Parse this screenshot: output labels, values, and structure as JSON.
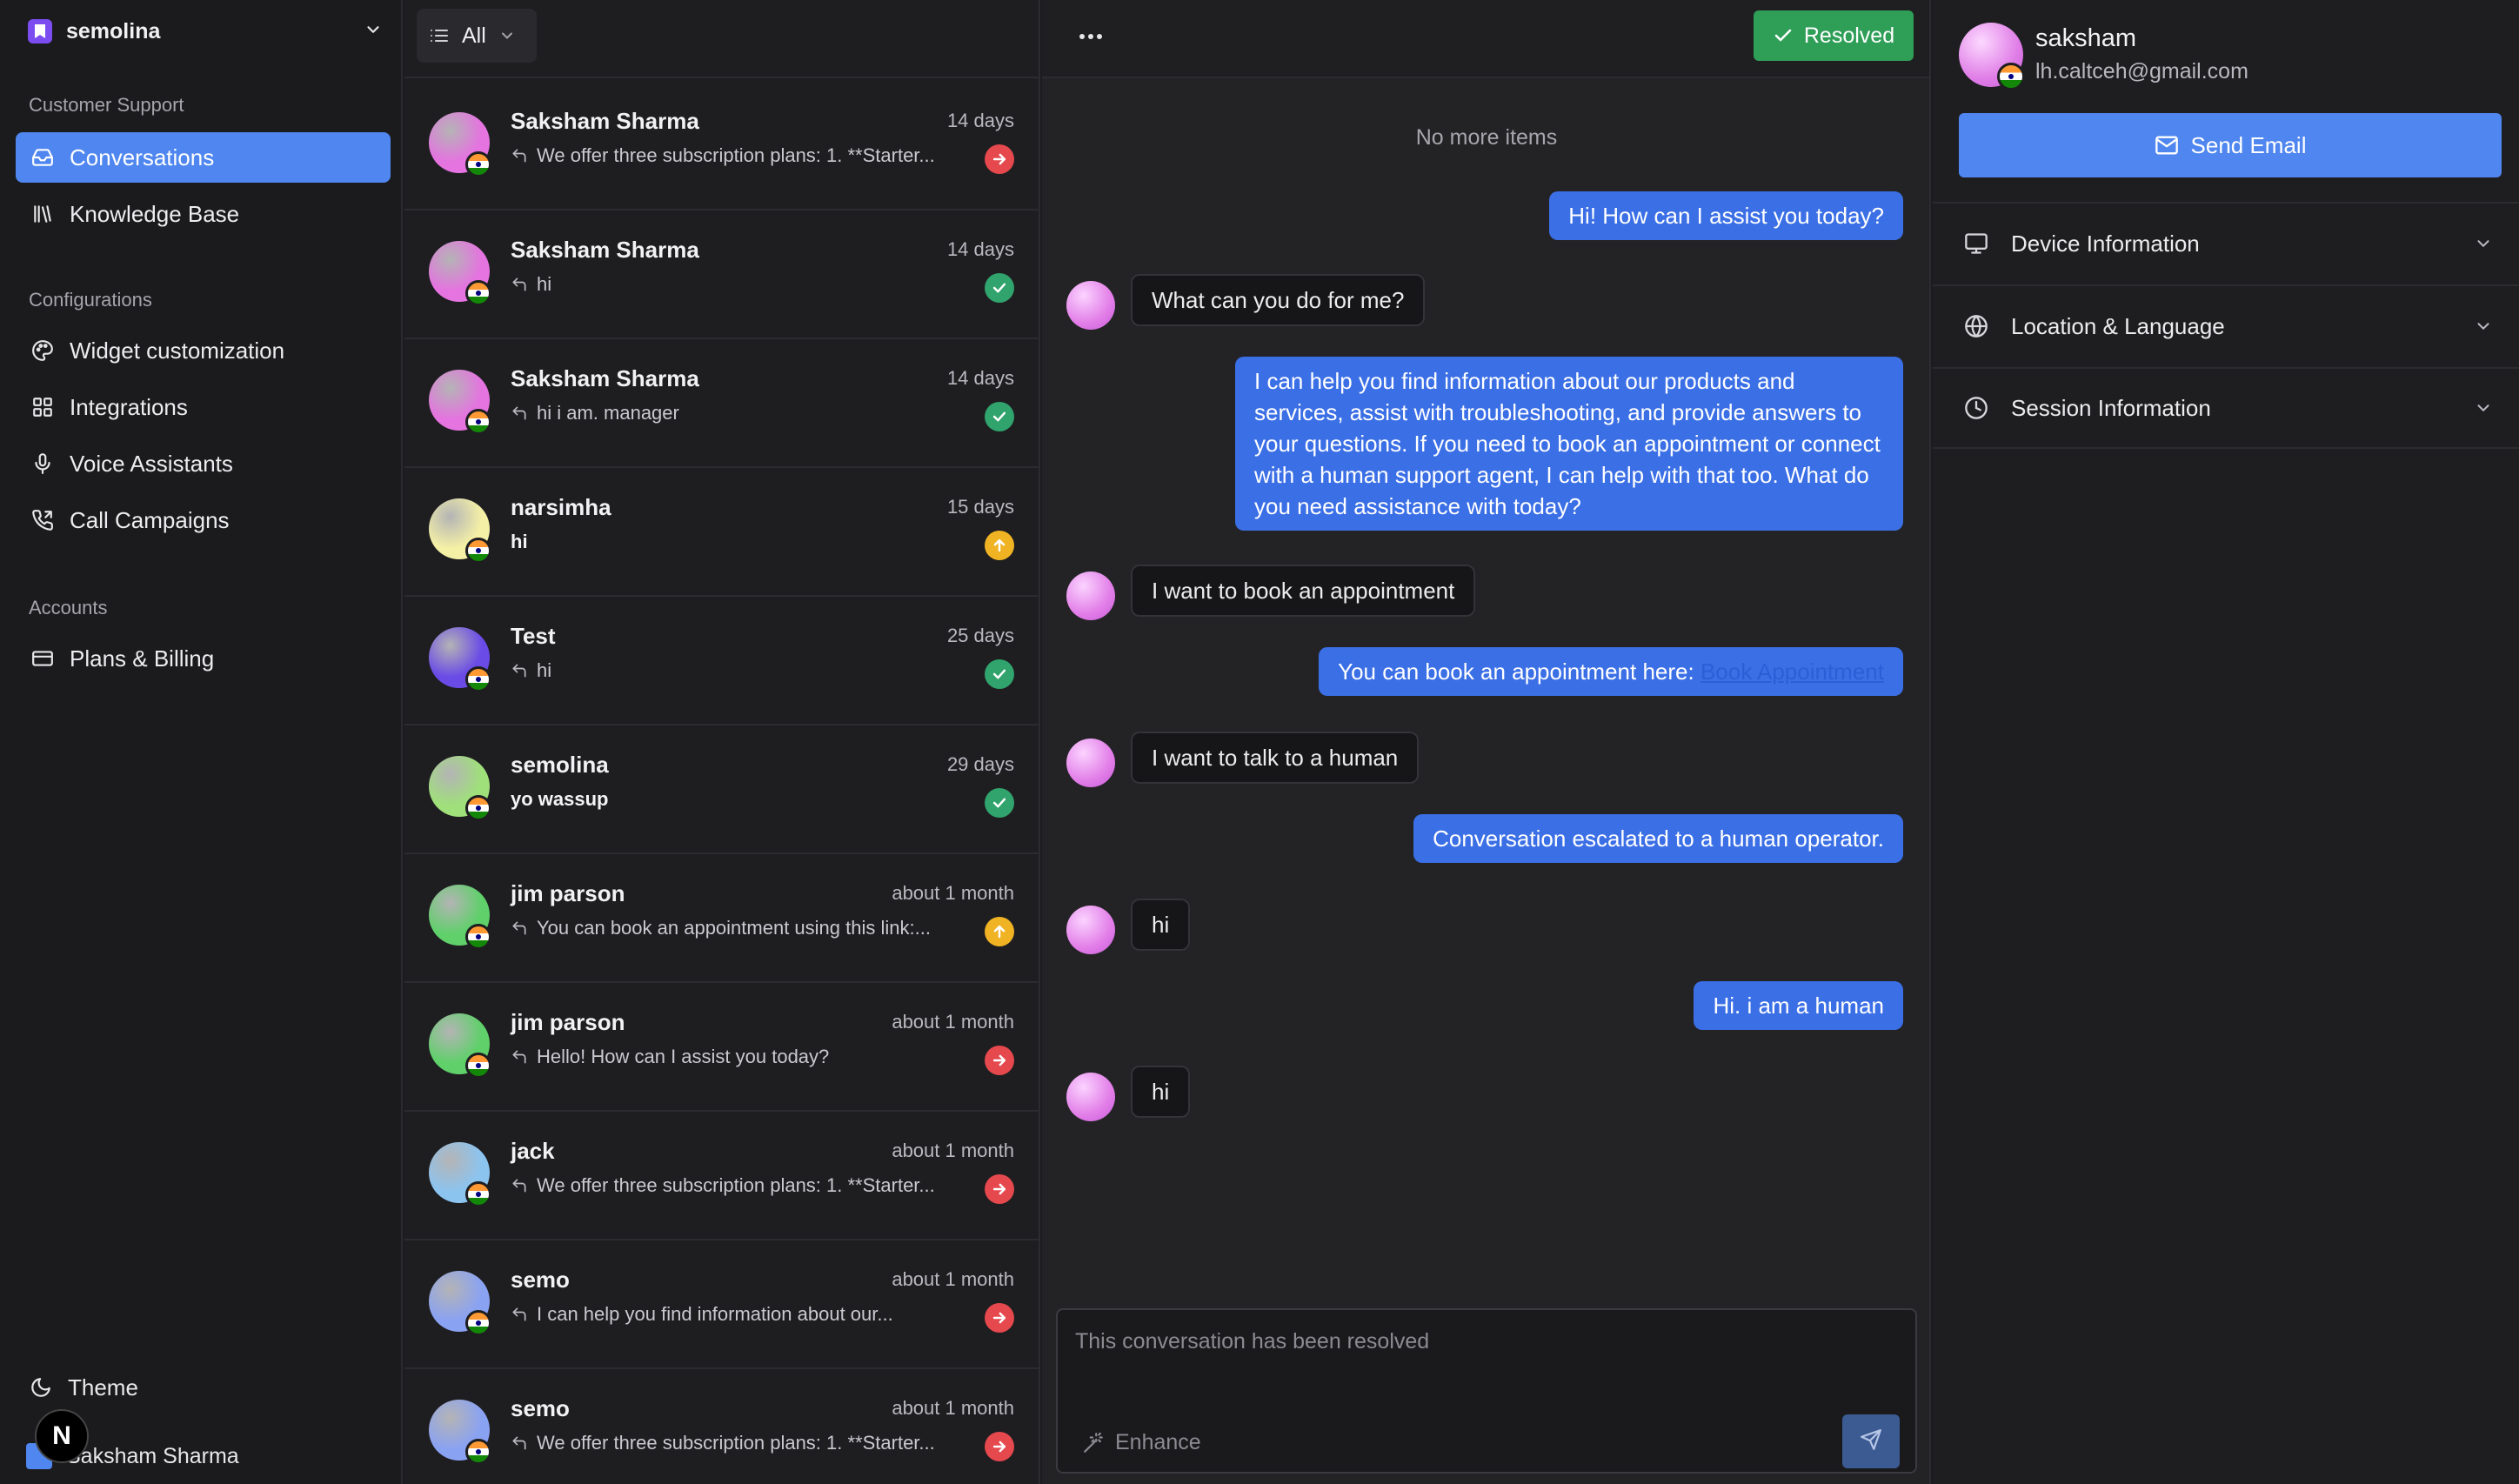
{
  "workspace": {
    "name": "semolina"
  },
  "sidebar": {
    "groups": [
      {
        "label": "Customer Support",
        "items": [
          {
            "label": "Conversations",
            "icon": "inbox-icon",
            "active": true
          },
          {
            "label": "Knowledge Base",
            "icon": "library-icon"
          }
        ]
      },
      {
        "label": "Configurations",
        "items": [
          {
            "label": "Widget customization",
            "icon": "palette-icon"
          },
          {
            "label": "Integrations",
            "icon": "grid-icon"
          },
          {
            "label": "Voice Assistants",
            "icon": "microphone-icon"
          },
          {
            "label": "Call Campaigns",
            "icon": "phone-icon"
          }
        ]
      },
      {
        "label": "Accounts",
        "items": [
          {
            "label": "Plans & Billing",
            "icon": "credit-card-icon"
          }
        ]
      }
    ],
    "theme_label": "Theme",
    "user_name": "Saksham Sharma",
    "badge": "N"
  },
  "list": {
    "filter_label": "All",
    "conversations": [
      {
        "name": "Saksham Sharma",
        "time": "14 days",
        "preview": "We offer three subscription plans: 1. **Starter...",
        "status": "red",
        "reply": true,
        "avatar": "#e573e0"
      },
      {
        "name": "Saksham Sharma",
        "time": "14 days",
        "preview": "hi",
        "status": "green",
        "reply": true,
        "avatar": "#e573e0"
      },
      {
        "name": "Saksham Sharma",
        "time": "14 days",
        "preview": "hi i am. manager",
        "status": "green",
        "reply": true,
        "avatar": "#e573e0"
      },
      {
        "name": "narsimha",
        "time": "15 days",
        "preview": "hi",
        "status": "yellow",
        "reply": false,
        "avatar": "#f4f0a6"
      },
      {
        "name": "Test",
        "time": "25 days",
        "preview": "hi",
        "status": "green",
        "reply": true,
        "avatar": "#6a4be6"
      },
      {
        "name": "semolina",
        "time": "29 days",
        "preview": "yo wassup",
        "status": "green",
        "reply": false,
        "avatar": "#9fe07a"
      },
      {
        "name": "jim parson",
        "time": "about 1 month",
        "preview": "You can book an appointment using this link:...",
        "status": "yellow",
        "reply": true,
        "avatar": "#5fd06a"
      },
      {
        "name": "jim parson",
        "time": "about 1 month",
        "preview": "Hello! How can I assist you today?",
        "status": "red",
        "reply": true,
        "avatar": "#5fd06a"
      },
      {
        "name": "jack",
        "time": "about 1 month",
        "preview": "We offer three subscription plans: 1. **Starter...",
        "status": "red",
        "reply": true,
        "avatar": "#8cc4f0"
      },
      {
        "name": "semo",
        "time": "about 1 month",
        "preview": "I can help you find information about our...",
        "status": "red",
        "reply": true,
        "avatar": "#8aa2f2"
      },
      {
        "name": "semo",
        "time": "about 1 month",
        "preview": "We offer three subscription plans: 1. **Starter...",
        "status": "red",
        "reply": true,
        "avatar": "#8aa2f2"
      }
    ]
  },
  "chat": {
    "resolved_label": "Resolved",
    "no_more": "No more items",
    "messages": [
      {
        "side": "agent",
        "text": "Hi! How can I assist you today?"
      },
      {
        "side": "user",
        "text": "What can you do for me?"
      },
      {
        "side": "agent",
        "text": "I can help you find information about our products and services, assist with troubleshooting, and provide answers to your questions. If you need to book an appointment or connect with a human support agent, I can help with that too. What do you need assistance with today?"
      },
      {
        "side": "user",
        "text": "I want to book an appointment"
      },
      {
        "side": "agent",
        "text": "You can book an appointment here: ",
        "link": "Book Appointment"
      },
      {
        "side": "user",
        "text": "I want to talk to a human"
      },
      {
        "side": "agent",
        "text": "Conversation escalated to a human operator."
      },
      {
        "side": "user",
        "text": "hi"
      },
      {
        "side": "agent",
        "text": "Hi. i am a human"
      },
      {
        "side": "user",
        "text": "hi"
      }
    ],
    "composer": {
      "placeholder": "This conversation has been resolved",
      "enhance_label": "Enhance"
    }
  },
  "panel": {
    "name": "saksham",
    "email": "lh.caltceh@gmail.com",
    "send_email_label": "Send Email",
    "sections": [
      {
        "label": "Device Information",
        "icon": "monitor-icon"
      },
      {
        "label": "Location & Language",
        "icon": "globe-icon"
      },
      {
        "label": "Session Information",
        "icon": "clock-icon"
      }
    ]
  }
}
